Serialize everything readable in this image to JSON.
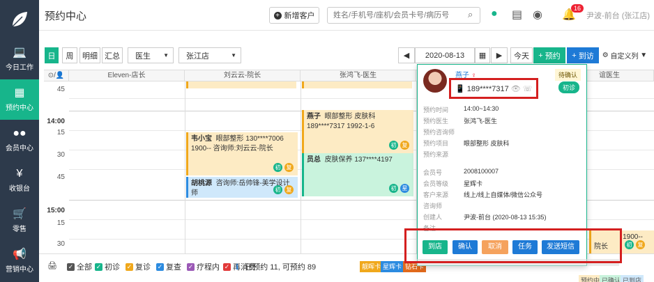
{
  "header": {
    "title": "预约中心",
    "add_customer": "新增客户",
    "search_placeholder": "姓名/手机号/座机/会员卡号/病历号",
    "notification_count": "16",
    "user": "尹波-前台 (张江店)"
  },
  "sidebar": {
    "items": [
      {
        "label": "今日工作",
        "icon": "laptop-icon"
      },
      {
        "label": "预约中心",
        "icon": "calendar-icon"
      },
      {
        "label": "会员中心",
        "icon": "users-icon"
      },
      {
        "label": "收银台",
        "icon": "yen-icon"
      },
      {
        "label": "零售",
        "icon": "cart-icon"
      },
      {
        "label": "营销中心",
        "icon": "megaphone-icon"
      }
    ]
  },
  "toolbar": {
    "views": [
      "日",
      "周",
      "明细",
      "汇总"
    ],
    "doctor_select": "医生",
    "store_select": "张江店",
    "date": "2020-08-13",
    "today": "今天",
    "appoint": "预约",
    "arrive": "到访",
    "custom": "自定义列"
  },
  "columns": [
    "Eleven-店长",
    "刘云云-院长",
    "张鸿飞-医生",
    "谊医生"
  ],
  "times": [
    "45",
    "14:00",
    "15",
    "30",
    "45",
    "15:00",
    "15",
    "30"
  ],
  "appointments": [
    {
      "name": "韦小宝",
      "info": "眼部整形  130****7006",
      "sub": "1900--  咨询师:刘云云-院长",
      "tags": [
        "初",
        "复"
      ]
    },
    {
      "name": "胡桃源",
      "info": "咨询师:岳帅锋-美学设计师",
      "tags": [
        "初",
        "复"
      ]
    },
    {
      "name": "燕子",
      "info": "眼部整形  皮肤科",
      "sub": "189****7317  1992-1-6",
      "tags": [
        "初",
        "复"
      ]
    },
    {
      "name": "员总",
      "info": "皮肤保养  137****4197",
      "tags": [
        "初",
        "星"
      ]
    },
    {
      "name": "",
      "info": "1900--",
      "sub": "院长",
      "tags": [
        "初",
        "复"
      ]
    }
  ],
  "popup": {
    "name": "燕子",
    "phone": "189****7317",
    "status": "待确认",
    "visit": "初诊",
    "rows": [
      {
        "k": "预约时间",
        "v": "14:00~14:30"
      },
      {
        "k": "预约医生",
        "v": "张鸿飞-医生"
      },
      {
        "k": "预约咨询师",
        "v": ""
      },
      {
        "k": "预约项目",
        "v": "眼部整形  皮肤科"
      },
      {
        "k": "预约来源",
        "v": ""
      },
      {
        "k": "会员号",
        "v": "2008100007"
      },
      {
        "k": "会员等级",
        "v": "星辉卡"
      },
      {
        "k": "客户来源",
        "v": "线上/线上自媒体/微信公众号"
      },
      {
        "k": "咨询师",
        "v": ""
      },
      {
        "k": "创建人",
        "v": "尹波-前台 (2020-08-13 15:35)"
      },
      {
        "k": "备注",
        "v": ""
      }
    ],
    "actions": [
      "到店",
      "确认",
      "取消",
      "任务",
      "发送短信"
    ]
  },
  "footer": {
    "checks": [
      {
        "label": "全部",
        "color": "#555555"
      },
      {
        "label": "初诊",
        "color": "#17b58b"
      },
      {
        "label": "复诊",
        "color": "#f0a81c"
      },
      {
        "label": "复查",
        "color": "#2c8be0"
      },
      {
        "label": "疗程内",
        "color": "#9b59b6"
      },
      {
        "label": "再消费",
        "color": "#e23a3a"
      }
    ],
    "summary": "已预约 11, 可预约 89",
    "legend": [
      "靓晖卡",
      "星辉卡",
      "钻石卡",
      "预约中",
      "已确认",
      "已到店"
    ]
  },
  "colors": {
    "primary": "#17b58b",
    "sidebar": "#2d3a4b",
    "blue": "#1e7ad6",
    "highlight": "#d41f1f"
  }
}
